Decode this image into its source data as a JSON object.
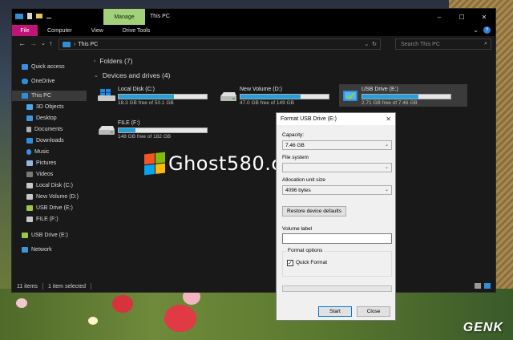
{
  "titlebar": {
    "manage_tab": "Manage",
    "title": "This PC",
    "minimize": "–",
    "maximize": "☐",
    "close": "✕"
  },
  "ribbon": {
    "file": "File",
    "tabs": [
      "Computer",
      "View",
      "Drive Tools"
    ],
    "collapse": "⌄",
    "help": "?"
  },
  "address": {
    "path": "This PC",
    "search_placeholder": "Search This PC",
    "back": "←",
    "forward": "→",
    "recent": "⌄",
    "up": "↑",
    "dropdown": "⌄",
    "refresh": "↻",
    "search_glyph": "⌕"
  },
  "nav": {
    "items": [
      {
        "label": "Quick access",
        "icon": "star-icon",
        "color": "#3a8ee6"
      },
      {
        "label": "OneDrive",
        "icon": "cloud-icon",
        "color": "#2e8fd8"
      },
      {
        "label": "This PC",
        "icon": "pc-icon",
        "color": "#2e8fd8"
      },
      {
        "label": "3D Objects",
        "icon": "cube-icon",
        "color": "#4aa8e8"
      },
      {
        "label": "Desktop",
        "icon": "desktop-icon",
        "color": "#3c96dc"
      },
      {
        "label": "Documents",
        "icon": "document-icon",
        "color": "#b0b0b0"
      },
      {
        "label": "Downloads",
        "icon": "download-icon",
        "color": "#2e8fd8"
      },
      {
        "label": "Music",
        "icon": "music-icon",
        "color": "#3a8ee6"
      },
      {
        "label": "Pictures",
        "icon": "picture-icon",
        "color": "#8fb9e0"
      },
      {
        "label": "Videos",
        "icon": "video-icon",
        "color": "#7a7a7a"
      },
      {
        "label": "Local Disk (C:)",
        "icon": "disk-icon",
        "color": "#c8c8c8"
      },
      {
        "label": "New Volume (D:)",
        "icon": "disk-icon",
        "color": "#c8c8c8"
      },
      {
        "label": "USB Drive (E:)",
        "icon": "usb-icon",
        "color": "#9ac94a"
      },
      {
        "label": "FILE (F:)",
        "icon": "disk-icon",
        "color": "#c8c8c8"
      },
      {
        "label": "USB Drive (E:)",
        "icon": "usb-icon",
        "color": "#9ac94a"
      },
      {
        "label": "Network",
        "icon": "network-icon",
        "color": "#3c96dc"
      }
    ]
  },
  "content": {
    "folders_header": "Folders (7)",
    "devices_header": "Devices and drives (4)",
    "drives": [
      {
        "name": "Local Disk (C:)",
        "free": "18.3 GB free of 50.1 GB",
        "used_fraction": 0.63,
        "icon": "windows-disk-icon"
      },
      {
        "name": "New Volume (D:)",
        "free": "47.0 GB free of 149 GB",
        "used_fraction": 0.68,
        "icon": "disk-icon"
      },
      {
        "name": "USB Drive (E:)",
        "free": "2.71 GB free of 7.46 GB",
        "used_fraction": 0.64,
        "icon": "usb-icon"
      },
      {
        "name": "FILE (F:)",
        "free": "148 GB free of 182 GB",
        "used_fraction": 0.19,
        "icon": "disk-icon"
      }
    ]
  },
  "status": {
    "items_count": "11 items",
    "selected": "1 item selected"
  },
  "dialog": {
    "title": "Format USB Drive (E:)",
    "close": "✕",
    "capacity_label": "Capacity:",
    "capacity_value": "7.46 GB",
    "filesystem_label": "File system",
    "filesystem_value": "",
    "allocation_label": "Allocation unit size",
    "allocation_value": "4096 bytes",
    "restore_button": "Restore device defaults",
    "volume_label": "Volume label",
    "volume_value": "",
    "format_options": "Format options",
    "quick_format": "Quick Format",
    "start": "Start",
    "close_button": "Close",
    "dropdown_arrow": "⌄",
    "check_mark": "✓"
  },
  "watermarks": {
    "ghost": "Ghost580.com",
    "genk": "GENK"
  },
  "colors": {
    "accent": "#26a0da",
    "file_tab": "#c0147a",
    "manage_tab": "#a2d179"
  }
}
